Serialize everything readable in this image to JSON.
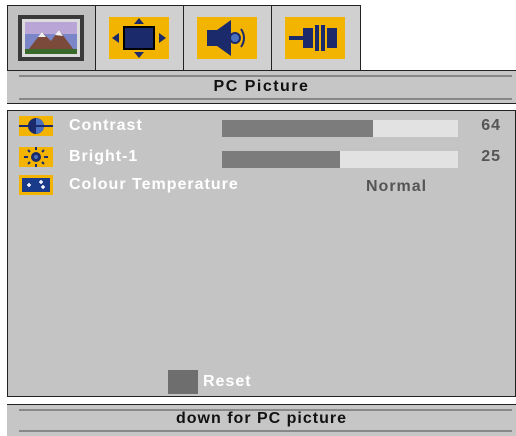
{
  "tabs": [
    {
      "icon": "picture-icon",
      "selected": true
    },
    {
      "icon": "screen-adjust-icon",
      "selected": false
    },
    {
      "icon": "sound-icon",
      "selected": false
    },
    {
      "icon": "connection-icon",
      "selected": false
    }
  ],
  "title": "PC Picture",
  "items": [
    {
      "icon": "contrast-icon",
      "label": "Contrast",
      "level": 64,
      "value": "64"
    },
    {
      "icon": "brightness-icon",
      "label": "Bright-1",
      "level": 50,
      "value": "25"
    },
    {
      "icon": "colour-temperature-icon",
      "label": "Colour Temperature",
      "value": "Normal"
    }
  ],
  "reset_label": "Reset",
  "hint": "down for PC picture",
  "colors": {
    "accent": "#f2b400",
    "panel": "#c4c4c4",
    "bar_fill": "#7c7c7c",
    "bar_track": "#e2e2e2"
  }
}
